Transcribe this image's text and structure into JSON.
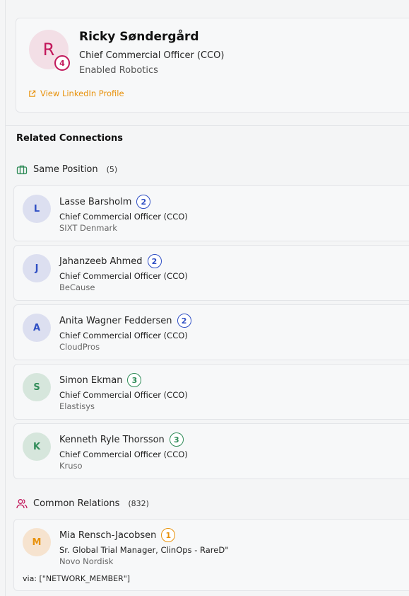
{
  "profile": {
    "initial": "R",
    "degree": "4",
    "name": "Ricky Søndergård",
    "title": "Chief Commercial Officer (CCO)",
    "company": "Enabled Robotics",
    "linkedin_label": "View LinkedIn Profile"
  },
  "related": {
    "title": "Related Connections",
    "same_position": {
      "icon": "briefcase-icon",
      "label": "Same Position",
      "count": "(5)",
      "items": [
        {
          "initial": "L",
          "name": "Lasse Barsholm",
          "degree": "2",
          "title": "Chief Commercial Officer (CCO)",
          "company": "SIXT Denmark"
        },
        {
          "initial": "J",
          "name": "Jahanzeeb Ahmed",
          "degree": "2",
          "title": "Chief Commercial Officer (CCO)",
          "company": "BeCause"
        },
        {
          "initial": "A",
          "name": "Anita Wagner Feddersen",
          "degree": "2",
          "title": "Chief Commercial Officer (CCO)",
          "company": "CloudPros"
        },
        {
          "initial": "S",
          "name": "Simon Ekman",
          "degree": "3",
          "title": "Chief Commercial Officer (CCO)",
          "company": "Elastisys"
        },
        {
          "initial": "K",
          "name": "Kenneth Ryle Thorsson",
          "degree": "3",
          "title": "Chief Commercial Officer (CCO)",
          "company": "Kruso"
        }
      ]
    },
    "common_relations": {
      "icon": "users-icon",
      "label": "Common Relations",
      "count": "(832)",
      "items": [
        {
          "initial": "M",
          "name": "Mia Rensch-Jacobsen",
          "degree": "1",
          "title": "Sr. Global Trial Manager, ClinOps - RareD\"",
          "company": "Novo Nordisk",
          "via": "via: [\"NETWORK_MEMBER\"]"
        }
      ]
    }
  },
  "colors": {
    "degree_1": "#e8920c",
    "degree_2": "#2f4fc4",
    "degree_3": "#2e8b57",
    "degree_4": "#c2185b",
    "link": "#e8920c"
  }
}
